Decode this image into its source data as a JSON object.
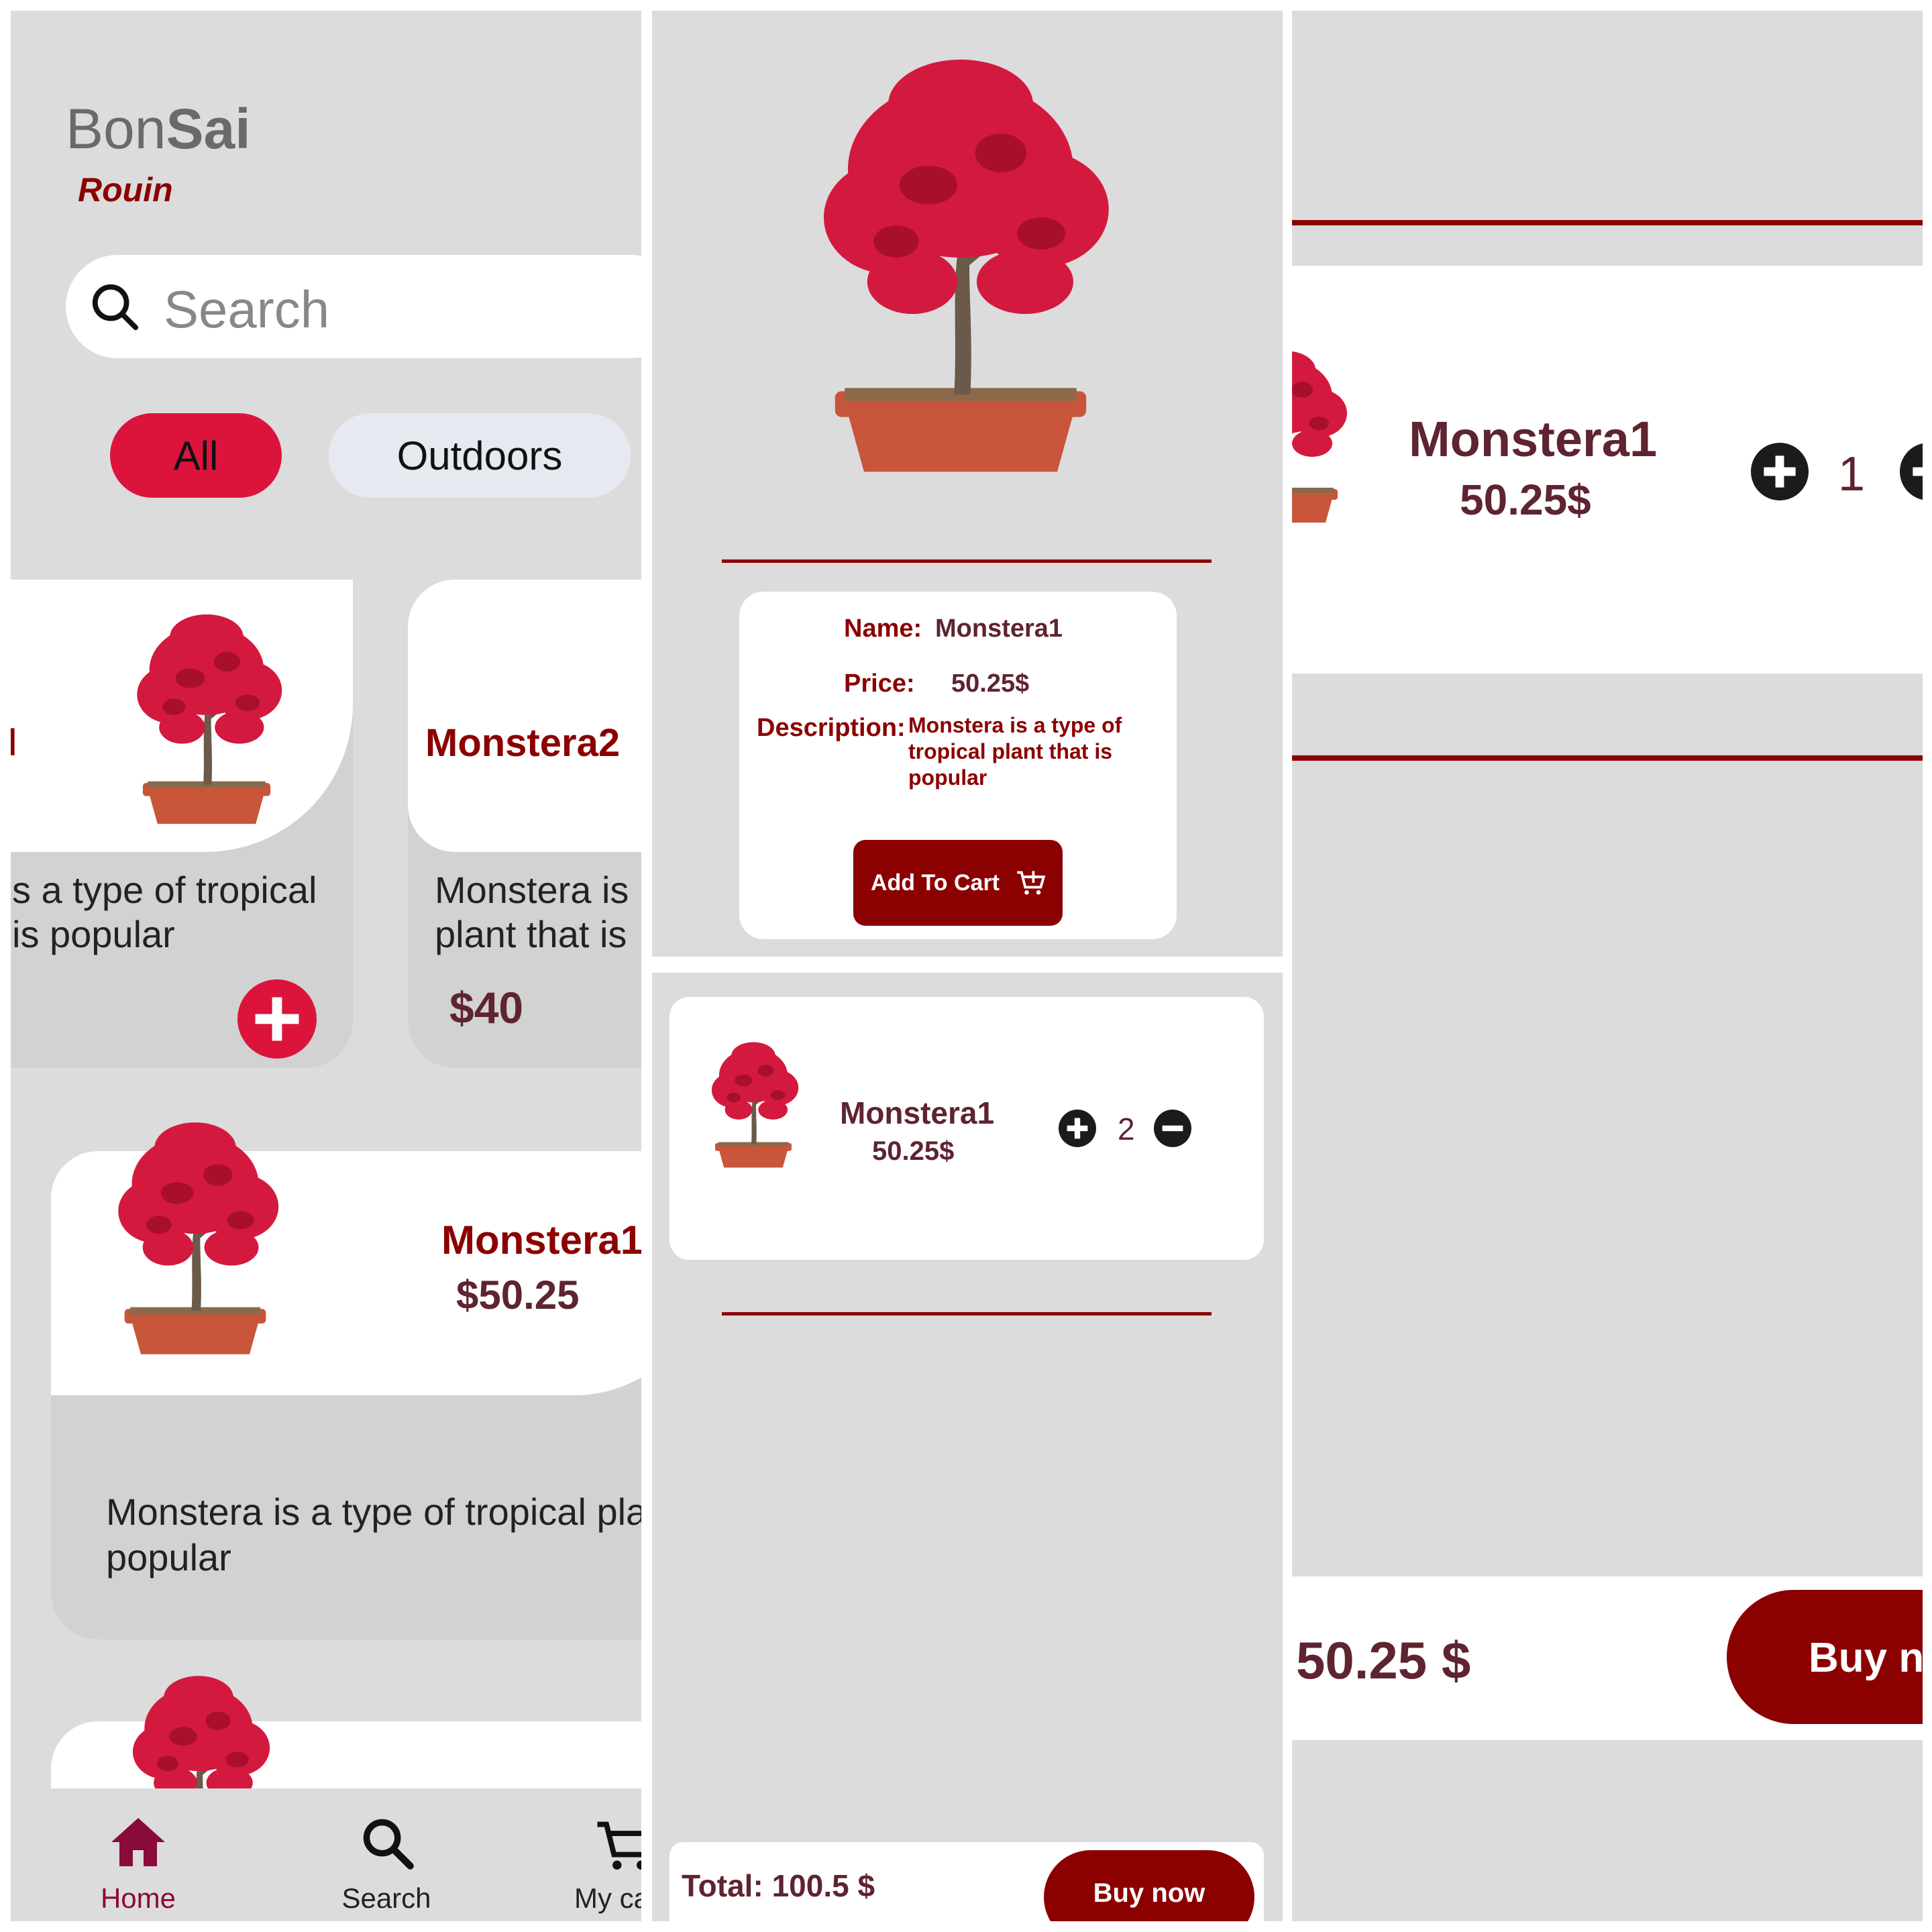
{
  "colors": {
    "accent": "#dc143c",
    "maroon": "#8b0000",
    "panel_bg": "#dcdcdc",
    "text_dark": "#5e2430"
  },
  "home": {
    "brand_light": "Bon",
    "brand_bold": "Sai",
    "subtitle": "Rouin",
    "search": {
      "placeholder": "Search",
      "icon": "search-icon"
    },
    "chips": [
      "All",
      "Outdoors"
    ],
    "card1": {
      "name": "l",
      "desc_line1": "s a type of tropical",
      "desc_line2": "is popular",
      "add_icon": "plus-icon"
    },
    "card2": {
      "name": "Monstera2",
      "desc_line1": "Monstera is",
      "desc_line2": "plant that is",
      "price": "$40"
    },
    "card3": {
      "name": "Monstera1",
      "price": "$50.25",
      "desc_line1": "Monstera is a type of tropical pla",
      "desc_line2": "popular"
    },
    "nav": [
      {
        "label": "Home",
        "icon": "home-icon"
      },
      {
        "label": "Search",
        "icon": "search-icon"
      },
      {
        "label": "My ca",
        "icon": "cart-icon"
      }
    ]
  },
  "detail": {
    "name_label": "Name:",
    "name_value": "Monstera1",
    "price_label": "Price:",
    "price_value": "50.25$",
    "desc_label": "Description:",
    "desc_line1": "Monstera is a type of",
    "desc_line2": "tropical plant that is",
    "desc_line3": "popular",
    "add_button": "Add To Cart",
    "add_icon": "cart-plus-icon"
  },
  "cart_small": {
    "item_name": "Monstera1",
    "item_price": "50.25$",
    "quantity": "2",
    "total": "Total: 100.5 $",
    "buy_button": "Buy now"
  },
  "cart_large": {
    "item_name": "Monstera1",
    "item_price": "50.25$",
    "quantity": "1",
    "total": "50.25 $",
    "buy_button": "Buy no"
  }
}
